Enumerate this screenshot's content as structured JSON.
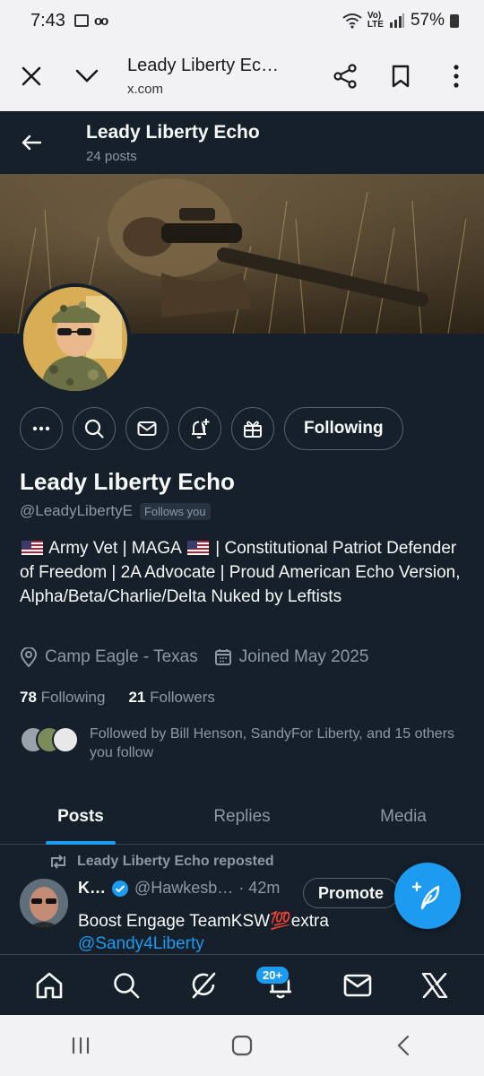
{
  "status_bar": {
    "time": "7:43",
    "battery": "57%",
    "network": "Vo)\nLTE"
  },
  "browser": {
    "title": "Leady Liberty Ec…",
    "url": "x.com"
  },
  "profile_header": {
    "name": "Leady Liberty Echo",
    "post_count": "24 posts"
  },
  "profile": {
    "display_name": "Leady Liberty Echo",
    "handle": "@LeadyLibertyE",
    "follows_you": "Follows you",
    "following_button": "Following",
    "bio_line1_a": "Army Vet | MAGA",
    "bio_line1_b": "| Constitutional Patriot",
    "bio_rest": "Defender of Freedom | 2A Advocate | Proud American Echo Version, Alpha/Beta/Charlie/Delta Nuked by Leftists",
    "location": "Camp Eagle - Texas",
    "joined": "Joined May 2025",
    "following_count": "78",
    "following_label": "Following",
    "followers_count": "21",
    "followers_label": "Followers",
    "followed_by": "Followed by Bill Henson, SandyFor Liberty, and 15 others you follow"
  },
  "tabs": [
    "Posts",
    "Replies",
    "Media"
  ],
  "post": {
    "repost_label": "Leady Liberty Echo reposted",
    "author": "K…",
    "handle": "@Hawkesb…",
    "time": "· 42m",
    "promote": "Promote",
    "text": "Boost Engage TeamKSW💯extra",
    "mention": "@Sandy4Liberty"
  },
  "nav": {
    "notifications_badge": "20+"
  },
  "colors": {
    "background": "#15202b",
    "accent": "#1d9bf0",
    "muted": "#8b98a5"
  }
}
